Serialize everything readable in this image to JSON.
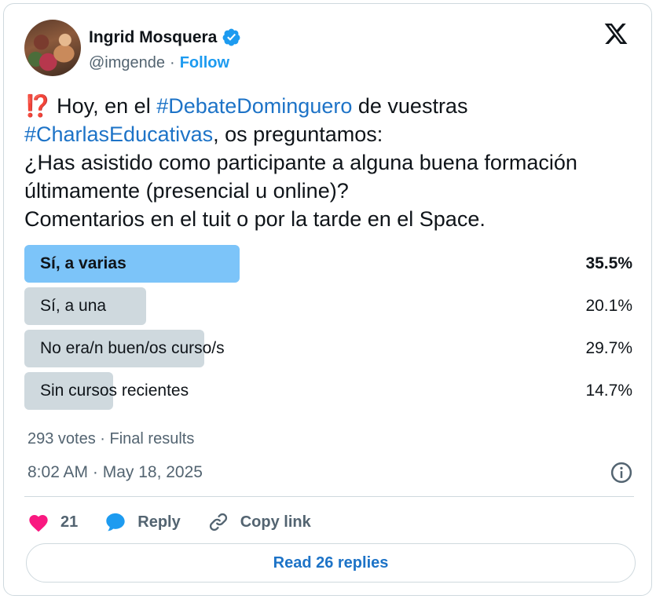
{
  "author": {
    "name": "Ingrid Mosquera",
    "handle": "@imgende",
    "separator": "·",
    "follow_label": "Follow"
  },
  "tweet": {
    "emoji": "⁉️",
    "line1_pre": " Hoy, en el ",
    "hashtag1": "#DebateDominguero",
    "line1_post": " de vuestras",
    "hashtag2": "#CharlasEducativas",
    "line2_post": ", os preguntamos:",
    "line3": "¿Has asistido como participante a alguna buena formación",
    "line4": "últimamente (presencial u online)?",
    "line5": "Comentarios en el tuit o por la tarde en el Space."
  },
  "poll": {
    "options": [
      {
        "label": "Sí, a varias",
        "percent_text": "35.5%",
        "percent": 35.5,
        "winner": true
      },
      {
        "label": "Sí, a una",
        "percent_text": "20.1%",
        "percent": 20.1,
        "winner": false
      },
      {
        "label": "No era/n buen/os curso/s",
        "percent_text": "29.7%",
        "percent": 29.7,
        "winner": false
      },
      {
        "label": "Sin cursos recientes",
        "percent_text": "14.7%",
        "percent": 14.7,
        "winner": false
      }
    ],
    "summary": "293 votes · Final results"
  },
  "timestamp": "8:02 AM · May 18, 2025",
  "actions": {
    "like_count": "21",
    "reply_label": "Reply",
    "copy_link_label": "Copy link"
  },
  "read_replies_label": "Read 26 replies",
  "colors": {
    "accent": "#1d9bf0",
    "hashtag": "#1d73c7",
    "winner_bar": "#7cc4f9",
    "bar": "#cfd9de",
    "heart": "#f91880"
  }
}
